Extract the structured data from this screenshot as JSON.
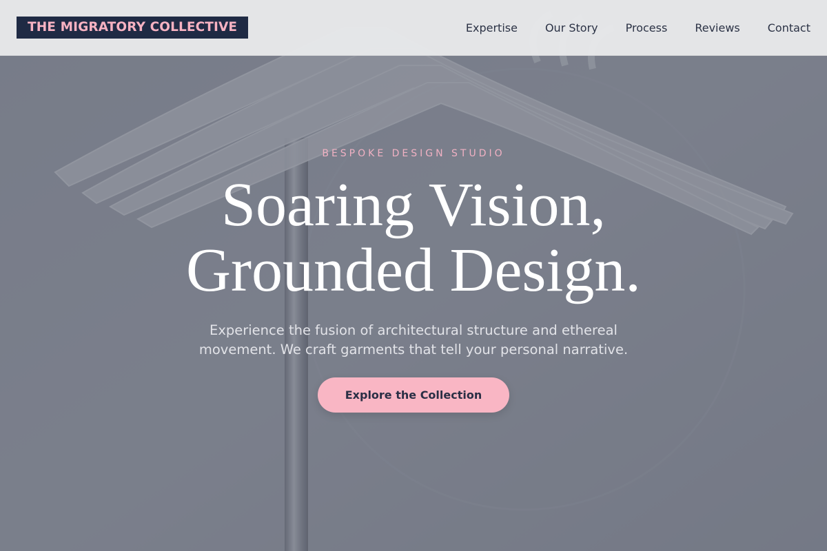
{
  "header": {
    "logo_text": "THE MIGRATORY COLLECTIVE",
    "nav": [
      {
        "label": "Expertise"
      },
      {
        "label": "Our Story"
      },
      {
        "label": "Process"
      },
      {
        "label": "Reviews"
      },
      {
        "label": "Contact"
      }
    ]
  },
  "hero": {
    "eyebrow": "BESPOKE DESIGN STUDIO",
    "headline_line1": "Soaring Vision,",
    "headline_line2": "Grounded Design.",
    "subtext": "Experience the fusion of architectural structure and ethereal movement. We craft garments that tell your personal narrative.",
    "cta_label": "Explore the Collection"
  },
  "colors": {
    "brand_navy": "#1f2a44",
    "accent_pink": "#f9b6c4",
    "eyebrow_pink": "#f1b1c3",
    "overlay_slate": "#60647a"
  },
  "background": {
    "subject": "clothing-hangers-on-rack-photo"
  }
}
